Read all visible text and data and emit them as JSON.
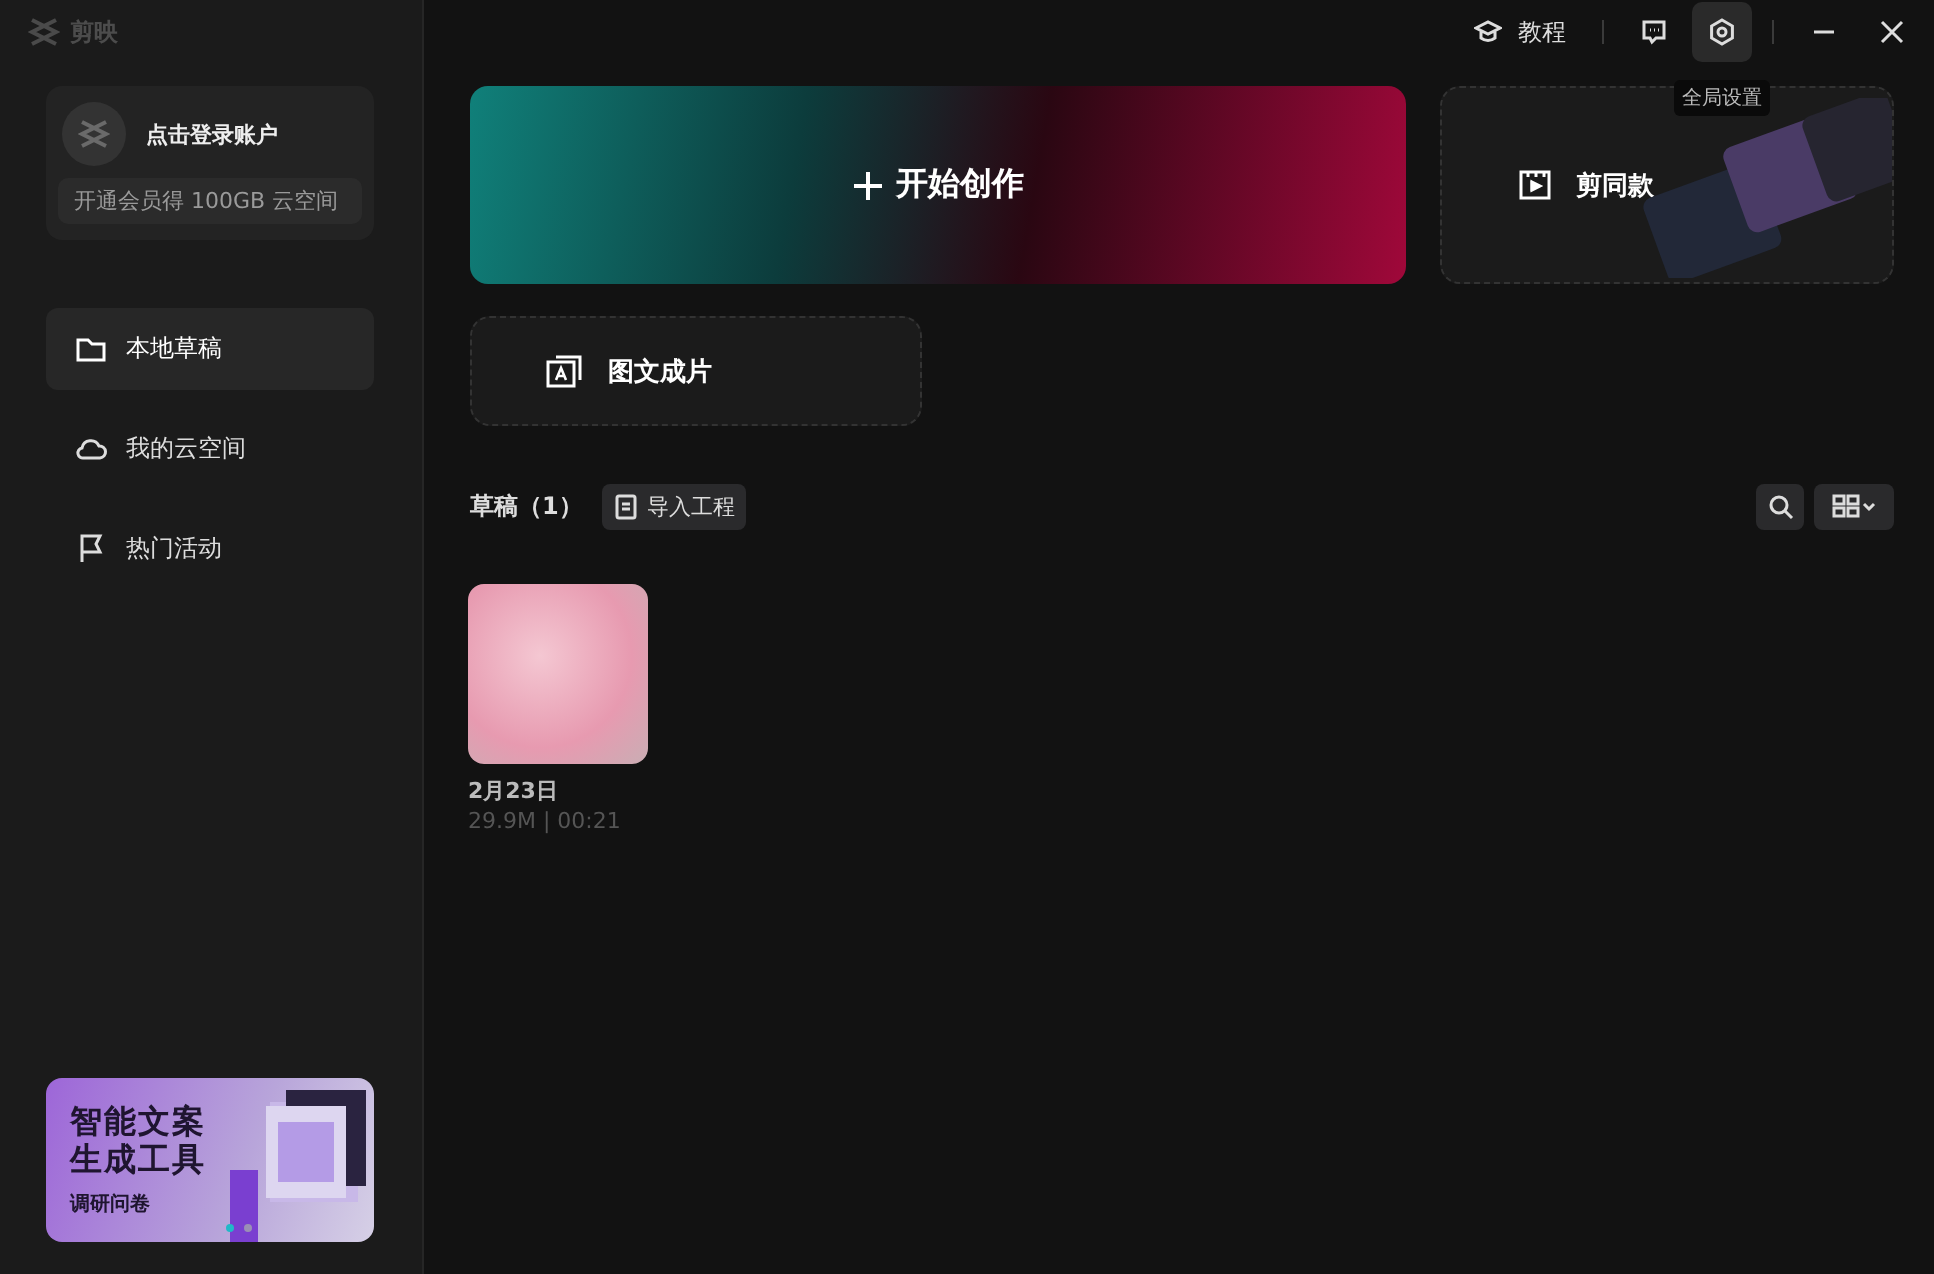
{
  "app": {
    "name": "剪映"
  },
  "account": {
    "login": "点击登录账户",
    "promo": "开通会员得 100GB 云空间"
  },
  "sidebar": {
    "items": [
      {
        "label": "本地草稿",
        "selected": true
      },
      {
        "label": "我的云空间",
        "selected": false
      },
      {
        "label": "热门活动",
        "selected": false
      }
    ]
  },
  "banner": {
    "title_lines": [
      "智能文案",
      "生成工具"
    ],
    "subtitle": "调研问卷",
    "dots": [
      {
        "selected": true
      },
      {
        "selected": false
      }
    ]
  },
  "topbar": {
    "tutorial": "教程",
    "settings_tooltip": "全局设置"
  },
  "create": {
    "primary": "开始创作",
    "template": "剪同款",
    "text_to_video": "图文成片"
  },
  "drafts": {
    "title": "草稿",
    "count": "（1）",
    "import": "导入工程",
    "items": [
      {
        "title": "2月23日",
        "meta": "29.9M | 00:21"
      }
    ]
  }
}
